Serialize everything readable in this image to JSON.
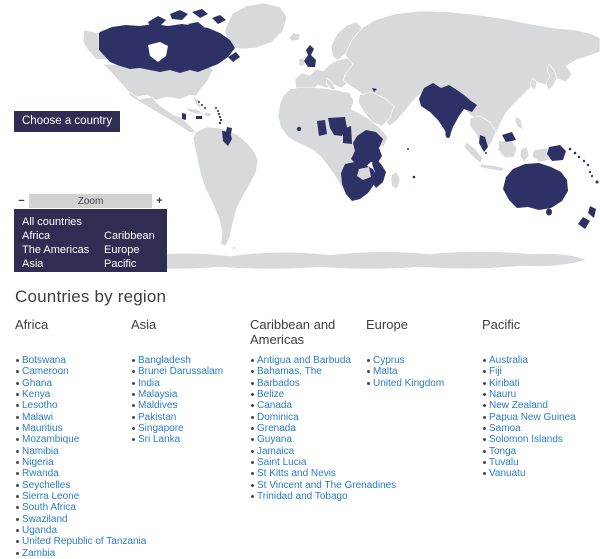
{
  "map": {
    "choose_button_label": "Choose a country",
    "zoom_control": {
      "label": "Zoom",
      "out": "−",
      "in": "+"
    },
    "region_filter": {
      "all_label": "All countries",
      "items": [
        "Africa",
        "Caribbean",
        "The Americas",
        "Europe",
        "Asia",
        "Pacific"
      ]
    },
    "colors": {
      "member": "#2e3166",
      "land": "#d8d9da",
      "panel": "#302d52",
      "zoombar": "#d2d2d3",
      "link": "#2b7cc4"
    }
  },
  "countries_by_region": {
    "title": "Countries by region",
    "columns": [
      {
        "label": "Africa",
        "countries": [
          "Botswana",
          "Cameroon",
          "Ghana",
          "Kenya",
          "Lesotho",
          "Malawi",
          "Mauritius",
          "Mozambique",
          "Namibia",
          "Nigeria",
          "Rwanda",
          "Seychelles",
          "Sierra Leone",
          "South Africa",
          "Swaziland",
          "Uganda",
          "United Republic of Tanzania",
          "Zambia"
        ]
      },
      {
        "label": "Asia",
        "countries": [
          "Bangladesh",
          "Brunei Darussalam",
          "India",
          "Malaysia",
          "Maldives",
          "Pakistan",
          "Singapore",
          "Sri Lanka"
        ]
      },
      {
        "label": "Caribbean and Americas",
        "countries": [
          "Antigua and Barbuda",
          "Bahamas, The",
          "Barbados",
          "Belize",
          "Canada",
          "Dominica",
          "Grenada",
          "Guyana",
          "Jamaica",
          "Saint Lucia",
          "St Kitts and Nevis",
          "St Vincent and The Grenadines",
          "Trinidad and Tobago"
        ]
      },
      {
        "label": "Europe",
        "countries": [
          "Cyprus",
          "Malta",
          "United Kingdom"
        ]
      },
      {
        "label": "Pacific",
        "countries": [
          "Australia",
          "Fiji",
          "Kiribati",
          "Nauru",
          "New Zealand",
          "Papua New Guinea",
          "Samoa",
          "Solomon Islands",
          "Tonga",
          "Tuvalu",
          "Vanuatu"
        ]
      }
    ]
  }
}
